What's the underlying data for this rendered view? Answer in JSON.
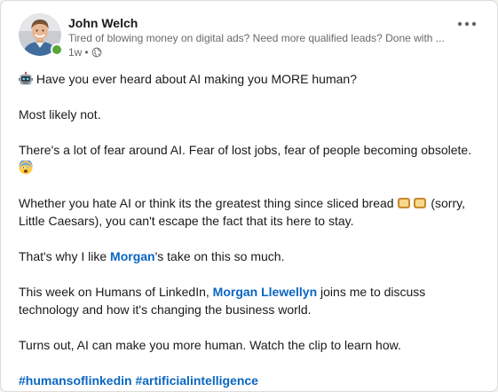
{
  "author": {
    "name": "John Welch",
    "headline": "Tired of blowing money on digital ads? Need more qualified leads? Done with ...",
    "time": "1w",
    "time_separator": "•"
  },
  "post": {
    "p1_text": "Have you ever heard about AI making you MORE human?",
    "p2_text": "Most likely not.",
    "p3_text": "There's a lot of fear around AI. Fear of lost jobs, fear of people becoming obsolete.",
    "p4_before": "Whether you hate AI or think its the greatest thing since sliced bread",
    "p4_after": "(sorry, Little Caesars), you can't escape the fact that its here to stay.",
    "p5_before": "That's why I like",
    "p5_mention": "Morgan",
    "p5_after": "'s take on this so much.",
    "p6_before": "This week on Humans of LinkedIn,",
    "p6_mention": "Morgan Llewellyn",
    "p6_after": "joins me to discuss technology and how it's changing the business world.",
    "p7_text": "Turns out, AI can make you more human. Watch the clip to learn how.",
    "hashtag_1": "#humansoflinkedin",
    "hashtag_2": "#artificialintelligence"
  },
  "icons": {
    "more": "ellipsis-icon",
    "visibility": "globe-icon",
    "robot": "robot-emoji",
    "fear": "fearful-face-emoji",
    "bread": "bread-emoji"
  },
  "colors": {
    "link": "#0a66c2",
    "online": "#57a639",
    "card": "#ffffff"
  }
}
